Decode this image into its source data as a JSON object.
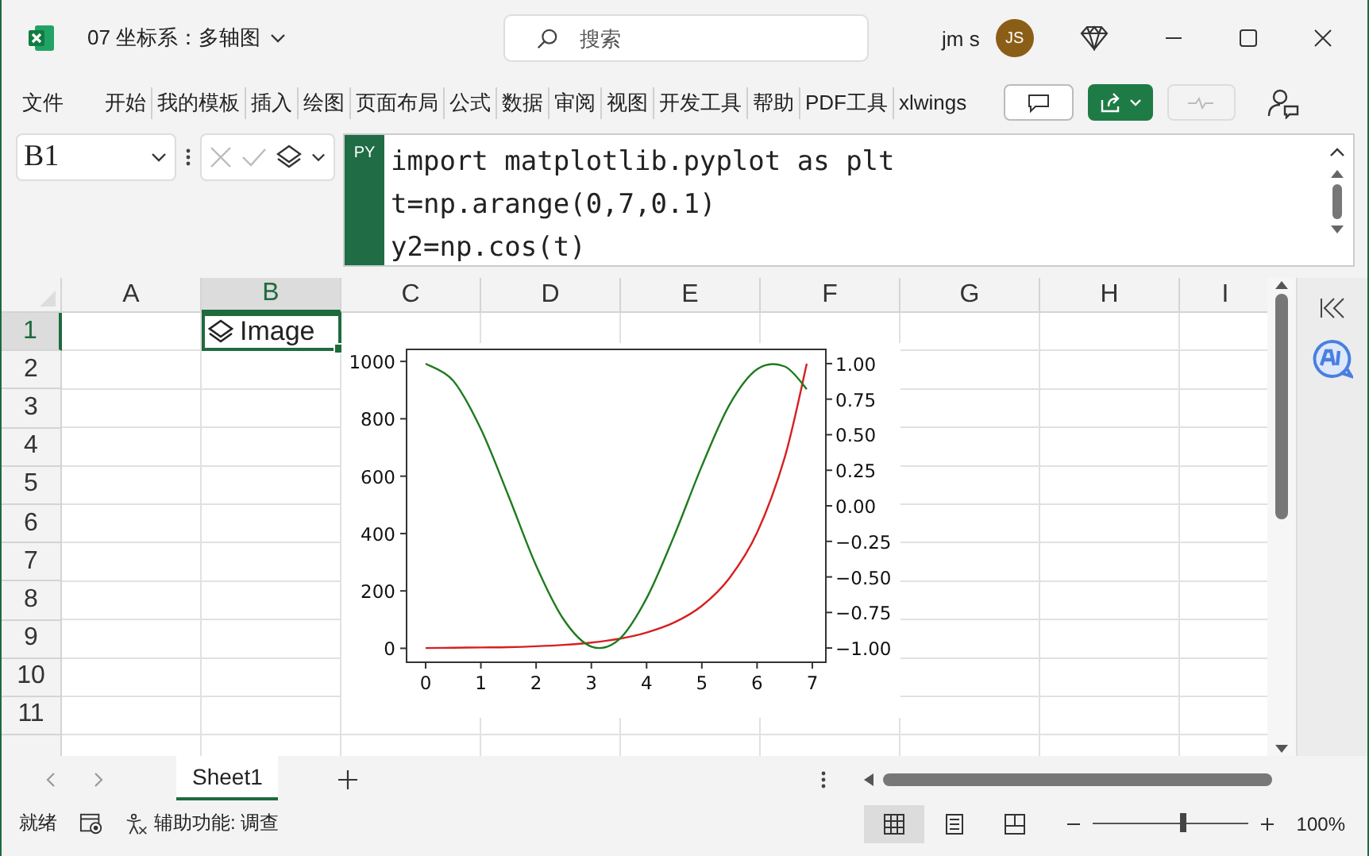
{
  "window": {
    "title": "07 坐标系：多轴图",
    "search_placeholder": "搜索",
    "user": "jm s",
    "avatar": "JS"
  },
  "ribbon_tabs": [
    "文件",
    "开始",
    "我的模板",
    "插入",
    "绘图",
    "页面布局",
    "公式",
    "数据",
    "审阅",
    "视图",
    "开发工具",
    "帮助",
    "PDF工具",
    "xlwings"
  ],
  "formula_bar": {
    "name_box": "B1",
    "badge": "PY",
    "code": [
      "import matplotlib.pyplot as plt",
      "t=np.arange(0,7,0.1)",
      "y2=np.cos(t)"
    ]
  },
  "grid": {
    "columns": [
      {
        "label": "A",
        "selected": false
      },
      {
        "label": "B",
        "selected": true
      },
      {
        "label": "C",
        "selected": false
      },
      {
        "label": "D",
        "selected": false
      },
      {
        "label": "E",
        "selected": false
      },
      {
        "label": "F",
        "selected": false
      },
      {
        "label": "G",
        "selected": false
      },
      {
        "label": "H",
        "selected": false
      },
      {
        "label": "I",
        "selected": false
      }
    ],
    "rows": [
      {
        "label": "1",
        "selected": true
      },
      {
        "label": "2",
        "selected": false
      },
      {
        "label": "3",
        "selected": false
      },
      {
        "label": "4",
        "selected": false
      },
      {
        "label": "5",
        "selected": false
      },
      {
        "label": "6",
        "selected": false
      },
      {
        "label": "7",
        "selected": false
      },
      {
        "label": "8",
        "selected": false
      },
      {
        "label": "9",
        "selected": false
      },
      {
        "label": "10",
        "selected": false
      },
      {
        "label": "11",
        "selected": false
      }
    ],
    "active_cell": {
      "kind": "image",
      "text": "Image"
    }
  },
  "chart": {
    "chart_data": {
      "type": "line",
      "x": [
        0,
        0.5,
        1,
        1.5,
        2,
        2.5,
        3,
        3.5,
        4,
        4.5,
        5,
        5.5,
        6,
        6.5,
        6.9
      ],
      "series": [
        {
          "color": "#d62020",
          "values": [
            1,
            2,
            3,
            4,
            7,
            12,
            20,
            33,
            55,
            90,
            148,
            245,
            403,
            665,
            992
          ]
        },
        {
          "color": "#1e7b1e",
          "axis": "y2",
          "values": [
            1,
            0.88,
            0.54,
            0.07,
            -0.42,
            -0.8,
            -0.99,
            -0.94,
            -0.65,
            -0.21,
            0.28,
            0.71,
            0.96,
            0.98,
            0.82
          ]
        }
      ],
      "xlim": [
        -0.345,
        7.245
      ],
      "ylim": [
        -48.6,
        1041.9
      ],
      "y2lim": [
        -1.1,
        1.1
      ],
      "xticks": [
        0,
        1,
        2,
        3,
        4,
        5,
        6,
        7
      ],
      "yticks": [
        0,
        200,
        400,
        600,
        800,
        1000
      ],
      "y2ticks": [
        {
          "value": -1,
          "label": "−1.00"
        },
        {
          "value": -0.75,
          "label": "−0.75"
        },
        {
          "value": -0.5,
          "label": "−0.50"
        },
        {
          "value": -0.25,
          "label": "−0.25"
        },
        {
          "value": 0,
          "label": "0.00"
        },
        {
          "value": 0.25,
          "label": "0.25"
        },
        {
          "value": 0.5,
          "label": "0.50"
        },
        {
          "value": 0.75,
          "label": "0.75"
        },
        {
          "value": 1,
          "label": "1.00"
        }
      ]
    }
  },
  "sheet_tabs": [
    {
      "label": "Sheet1",
      "selected": true
    }
  ],
  "status_bar": {
    "ready": "就绪",
    "accessibility": "辅助功能: 调查",
    "views": [
      {
        "kind": "normal",
        "selected": true
      },
      {
        "kind": "page_layout",
        "selected": false
      },
      {
        "kind": "page_break",
        "selected": false
      }
    ],
    "zoom": {
      "level": 0.58,
      "reading": "100%"
    }
  }
}
